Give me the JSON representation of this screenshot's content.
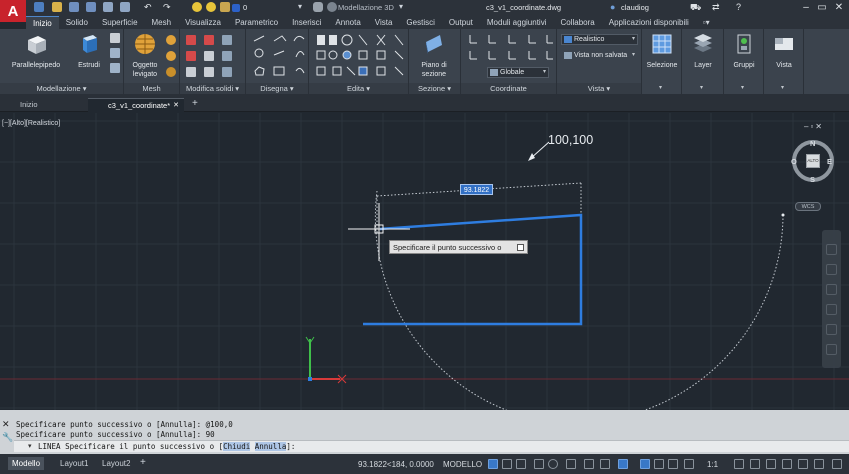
{
  "app": {
    "logo": "A",
    "workspace": "Modellazione 3D",
    "document_title": "c3_v1_coordinate.dwg",
    "user": "claudiog",
    "layer_combo": "0"
  },
  "ribbon_tabs": [
    {
      "label": "Inizio",
      "active": true
    },
    {
      "label": "Solido"
    },
    {
      "label": "Superficie"
    },
    {
      "label": "Mesh"
    },
    {
      "label": "Visualizza"
    },
    {
      "label": "Parametrico"
    },
    {
      "label": "Inserisci"
    },
    {
      "label": "Annota"
    },
    {
      "label": "Vista"
    },
    {
      "label": "Gestisci"
    },
    {
      "label": "Output"
    },
    {
      "label": "Moduli aggiuntivi"
    },
    {
      "label": "Collabora"
    },
    {
      "label": "Applicazioni disponibili"
    }
  ],
  "ribbon": {
    "parallelepipedo": "Parallelepipedo",
    "estrudi": "Estrudi",
    "oggetto_levigato_1": "Oggetto",
    "oggetto_levigato_2": "levigato",
    "piano_sezione_1": "Piano di",
    "piano_sezione_2": "sezione",
    "visual_style": "Realistico",
    "view_state": "Vista non salvata",
    "ucs": "Globale",
    "selezione": "Selezione",
    "layer": "Layer",
    "gruppi": "Gruppi",
    "vista_btn": "Vista",
    "panels": {
      "modellazione": "Modellazione",
      "mesh": "Mesh",
      "modifica_solidi": "Modifica solidi",
      "disegna": "Disegna",
      "edita": "Edita",
      "sezione": "Sezione",
      "coordinate": "Coordinate",
      "vista": "Vista"
    }
  },
  "file_tabs": [
    {
      "label": "Inizio"
    },
    {
      "label": "c3_v1_coordinate*",
      "active": true
    }
  ],
  "viewport": {
    "label": "[−][Alto][Realistico]",
    "coord_label": "100,100",
    "dynamic_input": "93.1822",
    "tooltip": "Specificare il punto successivo o",
    "viewcube": {
      "north": "N",
      "south": "S",
      "east": "E",
      "west": "O",
      "top": "ALTO"
    },
    "wcs": "WCS"
  },
  "command": {
    "history": [
      "Specificare punto successivo o [Annulla]: @100,0",
      "Specificare punto successivo o [Annulla]: 90"
    ],
    "prompt_prefix": "LINEA Specificare il punto successivo o [",
    "opt_chiudi": "Chiudi",
    "opt_annulla": "Annulla",
    "prompt_suffix": "]:"
  },
  "status": {
    "tabs": [
      {
        "label": "Modello",
        "active": true
      },
      {
        "label": "Layout1"
      },
      {
        "label": "Layout2"
      }
    ],
    "coords": "93.1822<184, 0.0000",
    "mode": "MODELLO",
    "scale": "1:1"
  },
  "colors": {
    "accent": "#2f7ad8",
    "drawn_line": "#2e7de0",
    "ucs_y": "#3fbf4a",
    "ucs_x": "#d83a3a"
  }
}
